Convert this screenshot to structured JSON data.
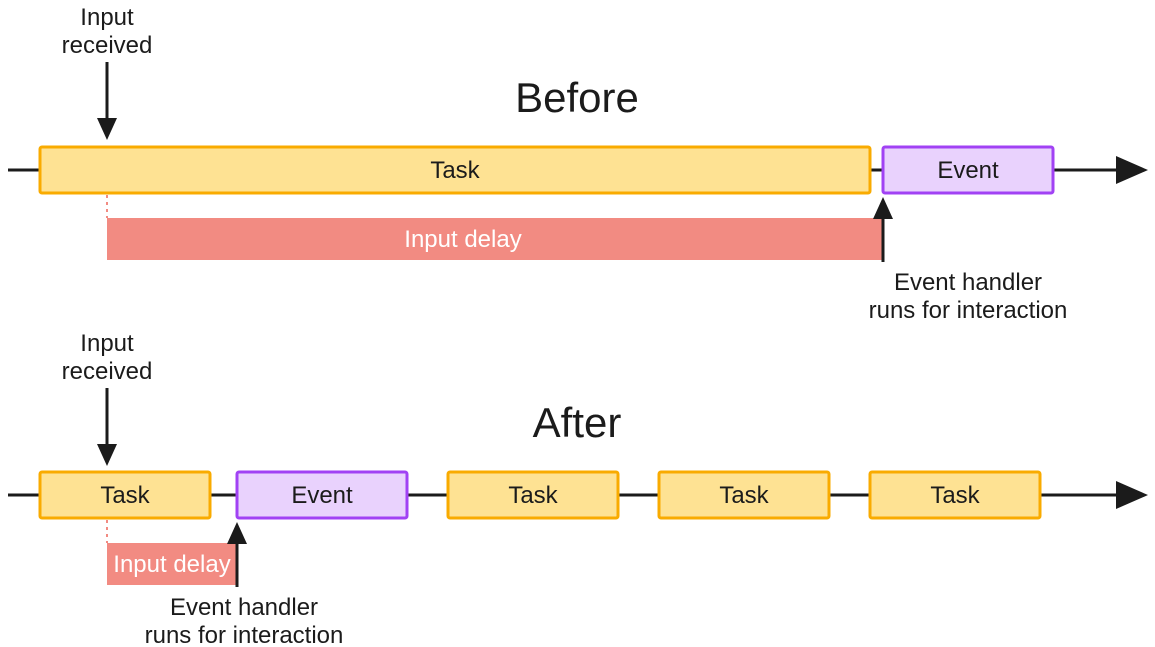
{
  "before": {
    "title": "Before",
    "input_received_label": "Input\nreceived",
    "task_label": "Task",
    "event_label": "Event",
    "input_delay_label": "Input delay",
    "handler_caption": "Event handler\nruns for interaction"
  },
  "after": {
    "title": "After",
    "input_received_label": "Input\nreceived",
    "task_labels": [
      "Task",
      "Task",
      "Task",
      "Task"
    ],
    "event_label": "Event",
    "input_delay_label": "Input delay",
    "handler_caption": "Event handler\nruns for interaction"
  },
  "colors": {
    "task_fill": "#fee293",
    "task_stroke": "#f9ab00",
    "event_fill": "#e9d2fd",
    "event_stroke": "#a142f4",
    "delay_fill": "#f28b82",
    "ink": "#1b1b1b"
  }
}
